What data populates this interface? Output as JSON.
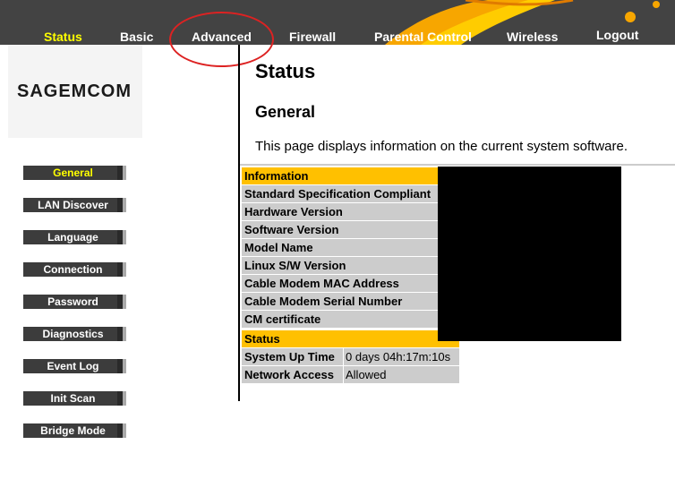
{
  "nav": {
    "items": [
      {
        "label": "Status",
        "active": true
      },
      {
        "label": "Basic"
      },
      {
        "label": "Advanced"
      },
      {
        "label": "Firewall"
      },
      {
        "label": "Parental Control"
      },
      {
        "label": "Wireless"
      },
      {
        "label": "Logout"
      }
    ]
  },
  "logo": {
    "text": "SAGEMCOM"
  },
  "sidebar": {
    "items": [
      {
        "label": "General",
        "active": true
      },
      {
        "label": "LAN Discover"
      },
      {
        "label": "Language"
      },
      {
        "label": "Connection"
      },
      {
        "label": "Password"
      },
      {
        "label": "Diagnostics"
      },
      {
        "label": "Event Log"
      },
      {
        "label": "Init Scan"
      },
      {
        "label": "Bridge Mode"
      }
    ]
  },
  "main": {
    "title": "Status",
    "subtitle": "General",
    "description": "This page displays information on the current system software.",
    "information_header": "Information",
    "information_rows": [
      {
        "label": "Standard Specification Compliant"
      },
      {
        "label": "Hardware Version"
      },
      {
        "label": "Software Version"
      },
      {
        "label": "Model Name"
      },
      {
        "label": "Linux S/W Version"
      },
      {
        "label": "Cable Modem MAC Address"
      },
      {
        "label": "Cable Modem Serial Number"
      },
      {
        "label": "CM certificate"
      }
    ],
    "status_header": "Status",
    "status_rows": [
      {
        "label": "System Up Time",
        "value": "0 days 04h:17m:10s"
      },
      {
        "label": "Network Access",
        "value": "Allowed"
      }
    ]
  },
  "colors": {
    "accent": "#ffc000",
    "nav_bg": "#434343",
    "active_text": "#ffff00",
    "highlight_circle": "#dd2222"
  }
}
